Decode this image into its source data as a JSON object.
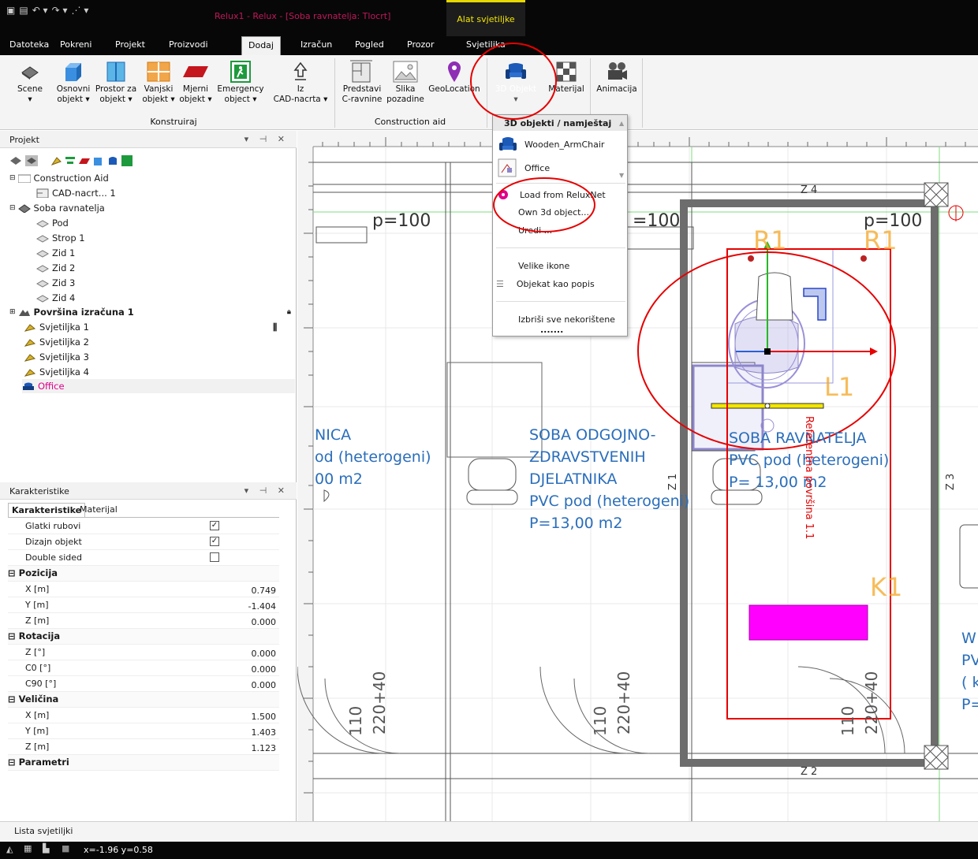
{
  "window": {
    "title": "Relux1 - Relux - [Soba ravnatelja: Tlocrt]",
    "context_group": "Alat svjetiljke"
  },
  "tabs": [
    "Datoteka",
    "Pokreni",
    "Projekt",
    "Proizvodi",
    "Dodaj",
    "Izračun",
    "Pogled",
    "Prozor",
    "Svjetiljka"
  ],
  "ribbon": {
    "scene": "Scene",
    "osnovni": [
      "Osnovni",
      "objekt ▾"
    ],
    "prostor": [
      "Prostor za",
      "objekt ▾"
    ],
    "vanjski": [
      "Vanjski",
      "objekt ▾"
    ],
    "mjerni": [
      "Mjerni",
      "objekt ▾"
    ],
    "emergency": [
      "Emergency",
      "object ▾"
    ],
    "iz_cad": [
      "Iz",
      "CAD-nacrta ▾"
    ],
    "predstavi": [
      "Predstavi",
      "C-ravnine"
    ],
    "slika": [
      "Slika",
      "pozadine"
    ],
    "geolocation": "GeoLocation",
    "obj3d": "3D Objekt",
    "materijal": "Materijal",
    "animacija": "Animacija",
    "group_konstruiraj": "Konstruiraj",
    "group_construction_aid": "Construction aid"
  },
  "dropdown": {
    "header": "3D objekti / namještaj",
    "items": [
      "Wooden_ArmChair",
      "Office"
    ],
    "load": "Load from ReluxNet",
    "own": "Own 3d object...",
    "uredi": "Uredi ...",
    "velike": "Velike ikone",
    "popis": "Objekat kao popis",
    "izbrisi": "Izbriši sve nekorištene",
    "dots": "......."
  },
  "project_panel": {
    "title": "Projekt",
    "tree": [
      "Construction Aid",
      "CAD-nacrt... 1",
      "Soba ravnatelja",
      "Pod",
      "Strop 1",
      "Zid 1",
      "Zid 2",
      "Zid 3",
      "Zid 4",
      "Površina izračuna 1",
      "Svjetiljka 1",
      "Svjetiljka 2",
      "Svjetiljka 3",
      "Svjetiljka 4",
      "Office"
    ]
  },
  "properties_panel": {
    "title": "Karakteristike",
    "tabs": [
      "Karakteristike",
      "Materijal"
    ],
    "checks": [
      {
        "label": "Glatki rubovi",
        "checked": true
      },
      {
        "label": "Dizajn objekt",
        "checked": true
      },
      {
        "label": "Double sided",
        "checked": false
      }
    ],
    "groups": [
      "Pozicija",
      "Rotacija",
      "Veličina",
      "Parametri"
    ],
    "pozicija": [
      {
        "label": "X [m]",
        "value": "0.749"
      },
      {
        "label": "Y [m]",
        "value": "-1.404"
      },
      {
        "label": "Z [m]",
        "value": "0.000"
      }
    ],
    "rotacija": [
      {
        "label": "Z [°]",
        "value": "0.000"
      },
      {
        "label": "C0 [°]",
        "value": "0.000"
      },
      {
        "label": "C90 [°]",
        "value": "0.000"
      }
    ],
    "velicina": [
      {
        "label": "X [m]",
        "value": "1.500"
      },
      {
        "label": "Y [m]",
        "value": "1.403"
      },
      {
        "label": "Z [m]",
        "value": "1.123"
      }
    ]
  },
  "canvas": {
    "p100_a": "p=100",
    "p100_b": "=100",
    "p100_c": "p=100",
    "z1": "Z 1",
    "z2": "Z 2",
    "z3": "Z 3",
    "z4": "Z 4",
    "r1": "R1",
    "l1": "L1",
    "k1": "K1",
    "room_left": [
      "NICA",
      "od (heterogeni)",
      "00 m2"
    ],
    "room_mid": [
      "SOBA ODGOJNO-",
      "ZDRAVSTVENIH",
      "DJELATNIKA",
      "PVC pod (heterogeni)",
      "P=13,00 m2"
    ],
    "room_right": [
      "SOBA RAVNATELJA",
      "PVC pod (heterogeni)",
      "P= 13,00 m2"
    ],
    "calc_plane": "Referentna površina 1.1",
    "door_a": "110",
    "door_b": "220+40",
    "edge_right": [
      "W",
      "PV",
      "( k",
      "P="
    ]
  },
  "lista": "Lista svjetiljki",
  "status": {
    "coords": "x=-1.96 y=0.58"
  },
  "colors": {
    "accent_magenta": "#ff00ff",
    "annotation_red": "#e60000",
    "label_orange": "#f5a623",
    "room_text": "#2a6ebb",
    "context_yellow": "#e6d800"
  }
}
